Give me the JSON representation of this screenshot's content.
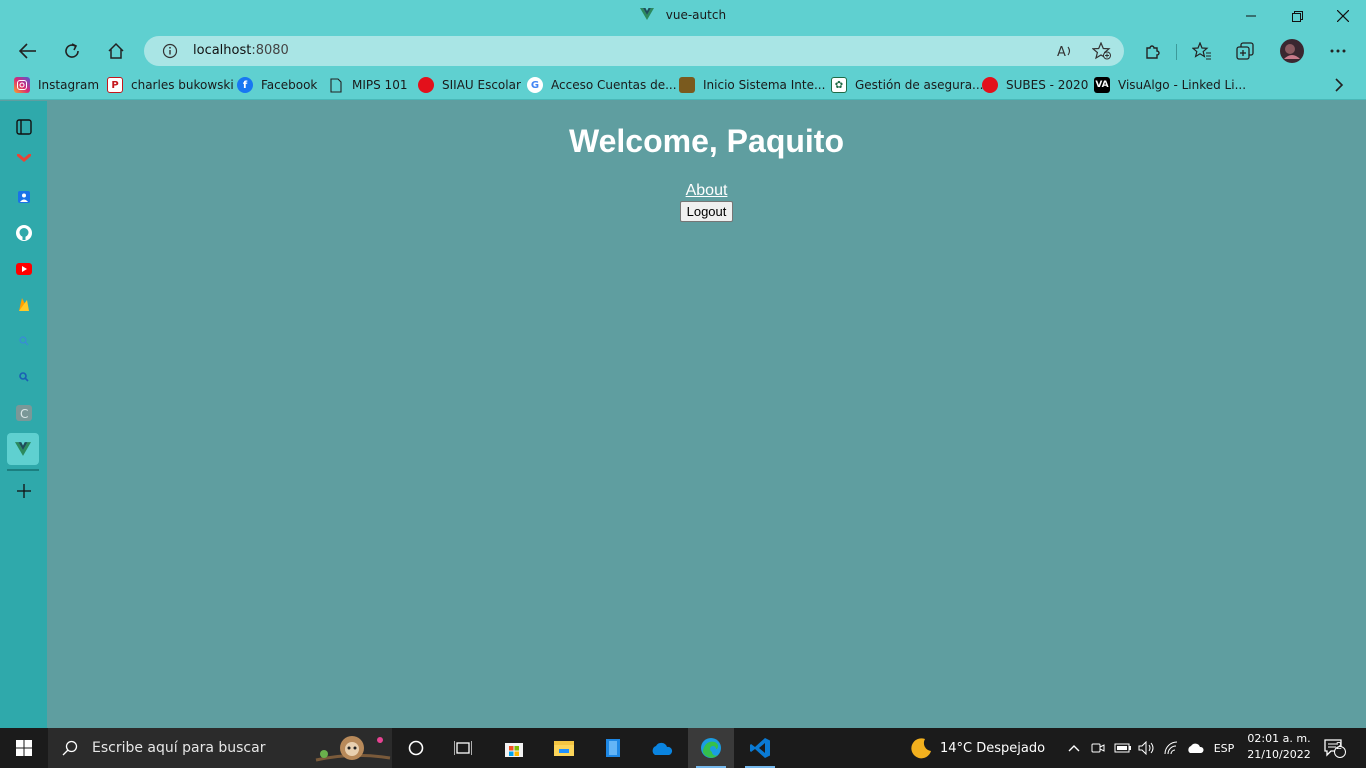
{
  "window": {
    "tab_title": "vue-autch",
    "minimize_label": "Minimize",
    "restore_label": "Restore",
    "close_label": "Close"
  },
  "toolbar": {
    "url_host": "localhost",
    "url_port": ":8080"
  },
  "bookmarks": [
    {
      "label": "Instagram",
      "icon": "instagram-icon"
    },
    {
      "label": "charles bukowski",
      "icon": "p-icon"
    },
    {
      "label": "Facebook",
      "icon": "facebook-icon"
    },
    {
      "label": "MIPS 101",
      "icon": "page-icon"
    },
    {
      "label": "SIIAU Escolar",
      "icon": "siiau-icon"
    },
    {
      "label": "Acceso  Cuentas de...",
      "icon": "google-icon"
    },
    {
      "label": "Inicio   Sistema Inte...",
      "icon": "crest-icon"
    },
    {
      "label": "Gestión de asegura...",
      "icon": "imss-icon"
    },
    {
      "label": "SUBES - 2020",
      "icon": "red-dot-icon"
    },
    {
      "label": "VisuAlgo - Linked Li...",
      "icon": "visualgo-icon"
    }
  ],
  "page": {
    "heading": "Welcome, Paquito",
    "about_link": "About",
    "logout_button": "Logout"
  },
  "taskbar": {
    "search_placeholder": "Escribe aquí para buscar",
    "weather": "14°C  Despejado",
    "language": "ESP",
    "time": "02:01 a. m.",
    "date": "21/10/2022",
    "notification_count": "2"
  },
  "colors": {
    "chrome": "#5fd0d0",
    "page_bg": "#5f9ea0",
    "sidebar": "#2fa9ab"
  }
}
